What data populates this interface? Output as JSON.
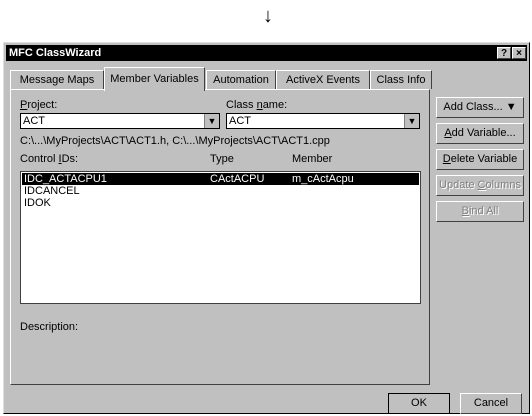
{
  "arrow": "↓",
  "window": {
    "title": "MFC ClassWizard",
    "help_btn": "?",
    "close_btn": "×"
  },
  "tabs": [
    {
      "label": "Message Maps"
    },
    {
      "label": "Member Variables",
      "active": true
    },
    {
      "label": "Automation"
    },
    {
      "label": "ActiveX Events"
    },
    {
      "label": "Class Info"
    }
  ],
  "project": {
    "label": "Project:",
    "value": "ACT"
  },
  "classname": {
    "label_pre": "Class ",
    "label_u": "n",
    "label_post": "ame:",
    "value": "ACT"
  },
  "path_text": "C:\\...\\MyProjects\\ACT\\ACT1.h, C:\\...\\MyProjects\\ACT\\ACT1.cpp",
  "columns": {
    "control": "Control IDs:",
    "type": "Type",
    "member": "Member"
  },
  "rows": [
    {
      "id": "IDC_ACTACPU1",
      "type": "CActACPU",
      "member": "m_cActAcpu",
      "selected": true
    },
    {
      "id": "IDCANCEL",
      "type": "",
      "member": ""
    },
    {
      "id": "IDOK",
      "type": "",
      "member": ""
    }
  ],
  "description_label": "Description:",
  "buttons": {
    "add_class": "Add Class...",
    "add_variable": "Add Variable...",
    "delete_variable": "Delete Variable",
    "update_columns": "Update Columns",
    "bind_all": "Bind All",
    "ok": "OK",
    "cancel": "Cancel"
  }
}
